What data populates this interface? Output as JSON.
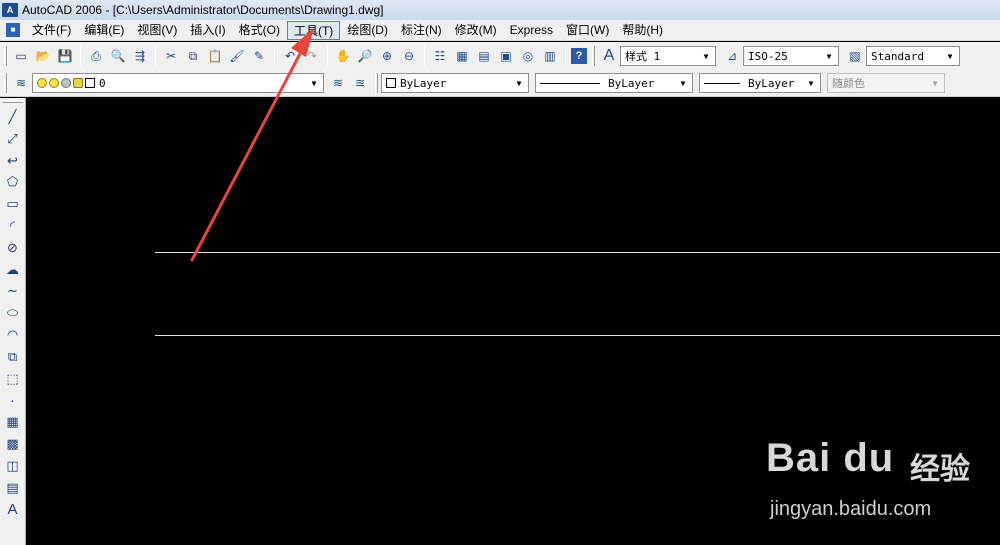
{
  "window": {
    "title": "AutoCAD 2006 - [C:\\Users\\Administrator\\Documents\\Drawing1.dwg]",
    "app_icon": "A"
  },
  "menu": {
    "items": [
      "文件(F)",
      "编辑(E)",
      "视图(V)",
      "插入(I)",
      "格式(O)",
      "工具(T)",
      "绘图(D)",
      "标注(N)",
      "修改(M)",
      "Express",
      "窗口(W)",
      "帮助(H)"
    ],
    "active_index": 5
  },
  "styles_toolbar": {
    "text_style": "样式 1",
    "dim_style": "ISO-25",
    "table_style": "Standard"
  },
  "layers_toolbar": {
    "current_layer": "0"
  },
  "properties_toolbar": {
    "color": "ByLayer",
    "linetype": "ByLayer",
    "lineweight": "ByLayer",
    "plot_style": "随颜色"
  },
  "icons": {
    "standard": [
      "new-icon",
      "open-icon",
      "save-icon",
      "plot-icon",
      "plot-preview-icon",
      "publish-icon",
      "cut-icon",
      "copy-icon",
      "paste-icon",
      "match-properties-icon",
      "block-editor-icon",
      "undo-icon",
      "redo-icon",
      "pan-icon",
      "zoom-realtime-icon",
      "zoom-window-icon",
      "zoom-previous-icon",
      "properties-icon",
      "design-center-icon",
      "tool-palettes-icon",
      "sheet-set-icon",
      "markup-icon",
      "calculator-icon",
      "help-icon"
    ],
    "draw": [
      "line-icon",
      "construction-line-icon",
      "polyline-icon",
      "polygon-icon",
      "rectangle-icon",
      "arc-icon",
      "circle-icon",
      "revision-cloud-icon",
      "spline-icon",
      "ellipse-icon",
      "ellipse-arc-icon",
      "insert-block-icon",
      "make-block-icon",
      "point-icon",
      "hatch-icon",
      "gradient-icon",
      "region-icon",
      "table-icon",
      "multiline-text-icon"
    ]
  },
  "watermark": {
    "logo": "Bai du",
    "cn": "经验",
    "url": "jingyan.baidu.com"
  },
  "colors": {
    "canvas": "#000000",
    "annotation_arrow": "#e8463a",
    "ui_background": "#f0f0f0"
  }
}
